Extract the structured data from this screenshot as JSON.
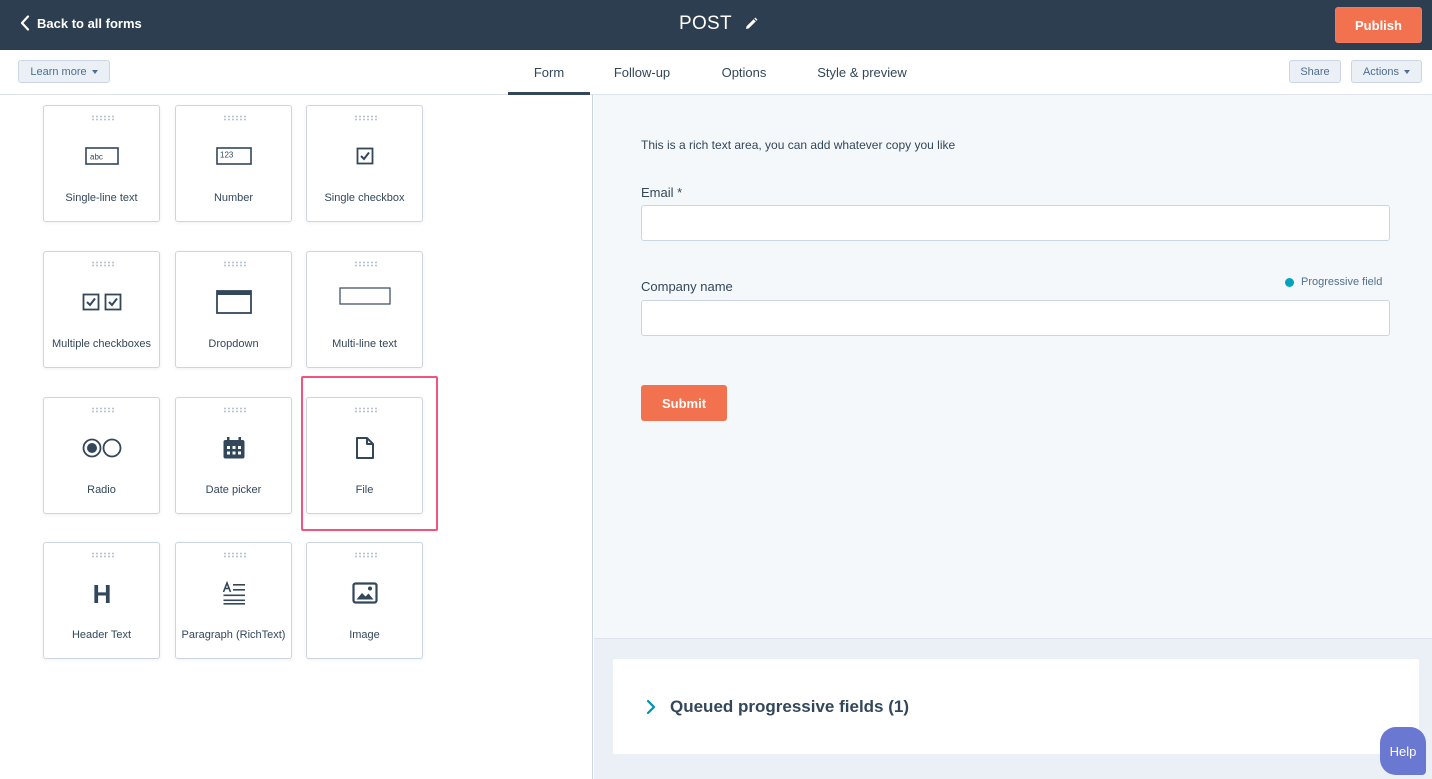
{
  "header": {
    "back_label": "Back to all forms",
    "form_title": "POST",
    "publish_label": "Publish"
  },
  "subnav": {
    "learn_more": "Learn more",
    "tabs": [
      "Form",
      "Follow-up",
      "Options",
      "Style & preview"
    ],
    "active_tab": "Form",
    "share": "Share",
    "actions": "Actions"
  },
  "fields": [
    {
      "label": "Single-line text",
      "icon": "single-line-text-icon"
    },
    {
      "label": "Number",
      "icon": "number-icon"
    },
    {
      "label": "Single checkbox",
      "icon": "single-checkbox-icon"
    },
    {
      "label": "Multiple checkboxes",
      "icon": "multiple-checkboxes-icon"
    },
    {
      "label": "Dropdown",
      "icon": "dropdown-icon"
    },
    {
      "label": "Multi-line text",
      "icon": "multi-line-text-icon"
    },
    {
      "label": "Radio",
      "icon": "radio-icon"
    },
    {
      "label": "Date picker",
      "icon": "calendar-icon"
    },
    {
      "label": "File",
      "icon": "file-icon"
    },
    {
      "label": "Header Text",
      "icon": "header-icon"
    },
    {
      "label": "Paragraph (RichText)",
      "icon": "paragraph-icon"
    },
    {
      "label": "Image",
      "icon": "image-icon"
    }
  ],
  "icon_text": {
    "abc": "abc",
    "num": "123",
    "header": "H"
  },
  "highlighted_field": "File",
  "preview": {
    "rich_text": "This is a rich text area, you can add whatever copy you like",
    "email_label": "Email *",
    "company_label": "Company name",
    "progressive_label": "Progressive field",
    "submit_label": "Submit"
  },
  "queued": {
    "title": "Queued progressive fields (1)"
  },
  "help_label": "Help",
  "colors": {
    "topbar": "#2d3e50",
    "accent": "#f2714f",
    "highlight": "#f2547d",
    "progressive_dot": "#00a4bd",
    "help": "#6a78d1"
  }
}
